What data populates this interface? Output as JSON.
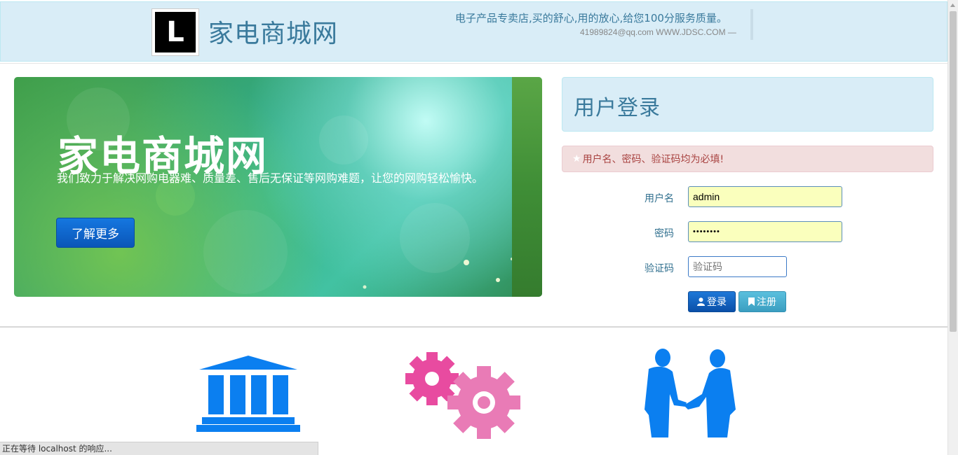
{
  "header": {
    "logo_letter": "L",
    "site_title": "家电商城网",
    "slogan": "电子产品专卖店,买的舒心,用的放心,给您100分服务质量。",
    "contact": "41989824@qq.com WWW.JDSC.COM —"
  },
  "banner": {
    "title": "家电商城网",
    "description": "我们致力于解决网购电器难、质量差、售后无保证等网购难题，让您的网购轻松愉快。",
    "button_label": "了解更多"
  },
  "login": {
    "title": "用户登录",
    "alert_star": "★",
    "alert_text": "用户名、密码、验证码均为必填!",
    "username_label": "用户名",
    "username_value": "admin",
    "password_label": "密码",
    "password_value": "••••••••",
    "captcha_label": "验证码",
    "captcha_placeholder": "验证码",
    "login_button": "登录",
    "register_button": "注册"
  },
  "features": {
    "icons": [
      "bank-building-icon",
      "gears-icon",
      "handshake-icon"
    ]
  },
  "statusbar": {
    "text": "正在等待 localhost 的响应..."
  },
  "colors": {
    "header_bg": "#d9edf7",
    "brand_text": "#3a7a9c",
    "alert_bg": "#f2dede",
    "alert_text": "#a94442",
    "primary_button": "#0a56b8",
    "info_button": "#5bc0de",
    "icon_blue": "#0b7ff0",
    "icon_pink": "#e84ba0"
  }
}
